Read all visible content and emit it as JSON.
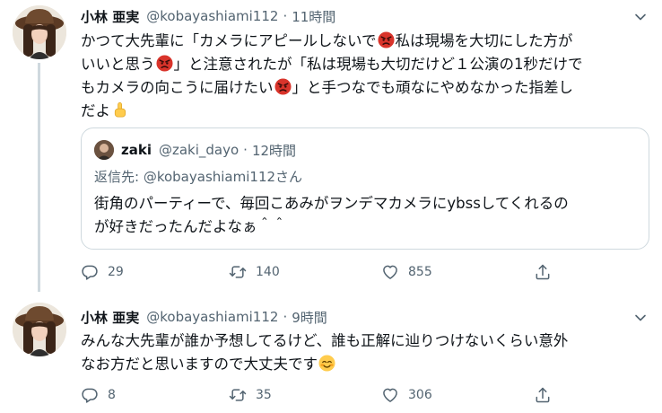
{
  "tweets": [
    {
      "name": "小林 亜実",
      "handle": "@kobayashiami112",
      "time": "11時間",
      "body_lines": [
        [
          "かつて大先輩に「カメラにアピールしないで",
          "angry-face-emoji",
          "私は現場を大切にした方が"
        ],
        [
          "いいと思う",
          "angry-face-emoji",
          "」と注意されたが「私は現場も大切だけど１公演の1秒だけで"
        ],
        [
          "もカメラの向こうに届けたい",
          "angry-face-emoji",
          "」と手つなでも頑なにやめなかった指差し"
        ],
        [
          "だよ",
          "pointing-up-emoji",
          ""
        ]
      ],
      "quote": {
        "name": "zaki",
        "handle": "@zaki_dayo",
        "time": "12時間",
        "reply_prefix": "返信先: ",
        "reply_to": "@kobayashiami112さん",
        "body_line1": "街角のパーティーで、毎回こあみがヲンデマカメラにybssしてくれるの",
        "body_line2": "が好きだったんだよなぁ＾＾"
      },
      "actions": {
        "replies": "29",
        "retweets": "140",
        "likes": "855"
      }
    },
    {
      "name": "小林 亜実",
      "handle": "@kobayashiami112",
      "time": "9時間",
      "body_line1": "みんな大先輩が誰か予想してるけど、誰も正解に辿りつけないくらい意外",
      "body_line2": "なお方だと思いますので大丈夫です",
      "body_emoji": "smiling-blush-emoji",
      "actions": {
        "replies": "8",
        "retweets": "35",
        "likes": "306"
      }
    }
  ],
  "separator": "·",
  "colors": {
    "text": "#0f1419",
    "secondary": "#536471",
    "border": "#cfd9de",
    "angry": "#d32f2f"
  }
}
